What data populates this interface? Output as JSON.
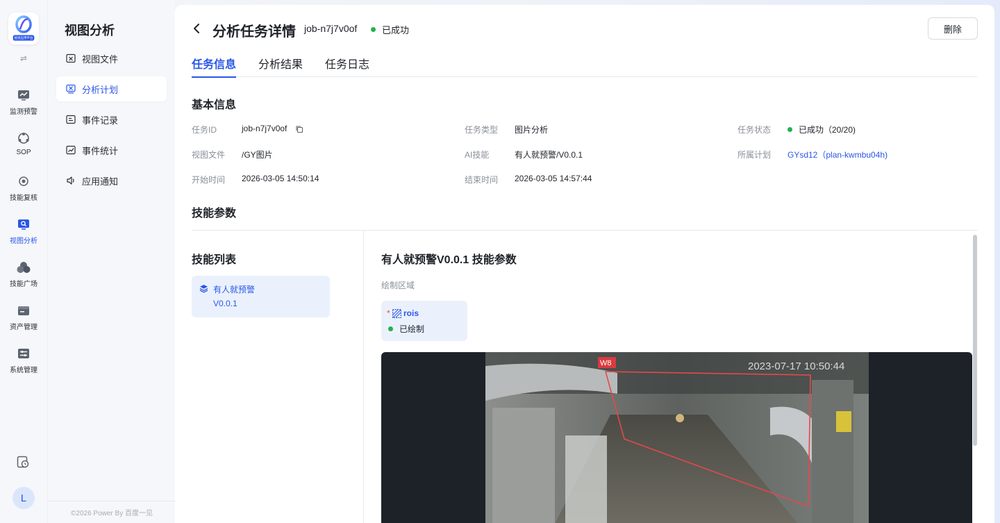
{
  "rail": {
    "logo_text": "视觉应用平台",
    "items": [
      {
        "label": "监测预警",
        "icon": "monitor-chart-icon"
      },
      {
        "label": "SOP",
        "icon": "sop-icon"
      },
      {
        "label": "技能复核",
        "icon": "skill-review-icon"
      },
      {
        "label": "视图分析",
        "icon": "view-analysis-icon"
      },
      {
        "label": "技能广场",
        "icon": "skill-plaza-icon"
      },
      {
        "label": "资产管理",
        "icon": "asset-icon"
      },
      {
        "label": "系统管理",
        "icon": "system-icon"
      }
    ],
    "active_index": 3,
    "avatar_letter": "L"
  },
  "subnav": {
    "title": "视图分析",
    "items": [
      {
        "label": "视图文件",
        "icon": "file-x-icon"
      },
      {
        "label": "分析计划",
        "icon": "plan-icon"
      },
      {
        "label": "事件记录",
        "icon": "record-icon"
      },
      {
        "label": "事件统计",
        "icon": "stats-icon"
      },
      {
        "label": "应用通知",
        "icon": "speaker-icon"
      }
    ],
    "active_index": 1,
    "footer": "©2026 Power By 百度一见"
  },
  "header": {
    "title": "分析任务详情",
    "job_id": "job-n7j7v0of",
    "status": "已成功",
    "delete_label": "删除"
  },
  "tabs": [
    "任务信息",
    "分析结果",
    "任务日志"
  ],
  "basic": {
    "section_title": "基本信息",
    "task_id_label": "任务ID",
    "task_id": "job-n7j7v0of",
    "task_type_label": "任务类型",
    "task_type": "图片分析",
    "task_status_label": "任务状态",
    "task_status": "已成功（20/20)",
    "view_file_label": "视图文件",
    "view_file": "/GY图片",
    "ai_skill_label": "AI技能",
    "ai_skill": "有人就预警/V0.0.1",
    "plan_label": "所属计划",
    "plan": "GYsd12（plan-kwmbu04h)",
    "start_label": "开始时间",
    "start_time": "2026-03-05 14:50:14",
    "end_label": "结束时间",
    "end_time": "2026-03-05 14:57:44"
  },
  "params": {
    "section_title": "技能参数",
    "list_title": "技能列表",
    "skill_name": "有人就预警",
    "skill_version": "V0.0.1",
    "detail_title": "有人就预警V0.0.1 技能参数",
    "draw_label": "绘制区域",
    "roi_required": "*",
    "roi_name": "rois",
    "roi_status": "已绘制",
    "preview_timestamp": "2023-07-17 10:50:44",
    "preview_camera_tag": "W8"
  },
  "colors": {
    "accent": "#2a56e8",
    "success": "#22b14c",
    "roi_line": "#e5484d"
  }
}
